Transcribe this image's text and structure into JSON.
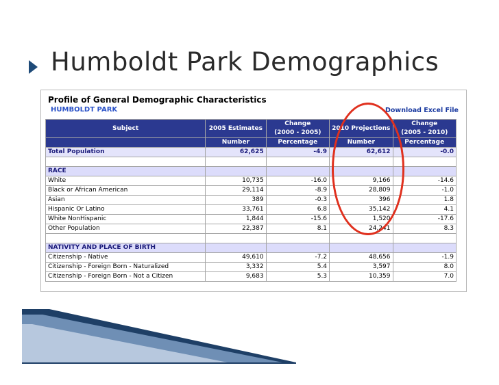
{
  "slide": {
    "title": "Humboldt Park Demographics"
  },
  "report": {
    "title": "Profile of General Demographic Characteristics",
    "area": "HUMBOLDT PARK",
    "download_label": "Download Excel File"
  },
  "table": {
    "headers": {
      "subject": "Subject",
      "est_2005": "2005 Estimates",
      "change_2000_2005_line1": "Change",
      "change_2000_2005_line2": "(2000 - 2005)",
      "proj_2010": "2010 Projections",
      "change_2005_2010_line1": "Change",
      "change_2005_2010_line2": "(2005 - 2010)"
    },
    "subheaders": {
      "number1": "Number",
      "percentage1": "Percentage",
      "number2": "Number",
      "percentage2": "Percentage"
    },
    "total": {
      "label": "Total Population",
      "est": "62,625",
      "chg1": "-4.9",
      "proj": "62,612",
      "chg2": "-0.0"
    },
    "race": {
      "label": "RACE",
      "rows": [
        {
          "label": "White",
          "est": "10,735",
          "chg1": "-16.0",
          "proj": "9,166",
          "chg2": "-14.6"
        },
        {
          "label": "Black or African American",
          "est": "29,114",
          "chg1": "-8.9",
          "proj": "28,809",
          "chg2": "-1.0"
        },
        {
          "label": "Asian",
          "est": "389",
          "chg1": "-0.3",
          "proj": "396",
          "chg2": "1.8"
        },
        {
          "label": "Hispanic Or Latino",
          "est": "33,761",
          "chg1": "6.8",
          "proj": "35,142",
          "chg2": "4.1"
        },
        {
          "label": "White NonHispanic",
          "est": "1,844",
          "chg1": "-15.6",
          "proj": "1,520",
          "chg2": "-17.6"
        },
        {
          "label": "Other Population",
          "est": "22,387",
          "chg1": "8.1",
          "proj": "24,241",
          "chg2": "8.3"
        }
      ]
    },
    "nativity": {
      "label": "NATIVITY AND PLACE OF BIRTH",
      "rows": [
        {
          "label": "Citizenship - Native",
          "est": "49,610",
          "chg1": "-7.2",
          "proj": "48,656",
          "chg2": "-1.9"
        },
        {
          "label": "Citizenship - Foreign Born - Naturalized",
          "est": "3,332",
          "chg1": "5.4",
          "proj": "3,597",
          "chg2": "8.0"
        },
        {
          "label": "Citizenship - Foreign Born - Not a Citizen",
          "est": "9,683",
          "chg1": "5.3",
          "proj": "10,359",
          "chg2": "7.0"
        }
      ]
    }
  },
  "colors": {
    "header_bg": "#2b3990",
    "section_bg": "#dcdcfb",
    "highlight_circle": "#e0301e",
    "title_text": "#2a2a2a",
    "bullet": "#1e4a78"
  }
}
